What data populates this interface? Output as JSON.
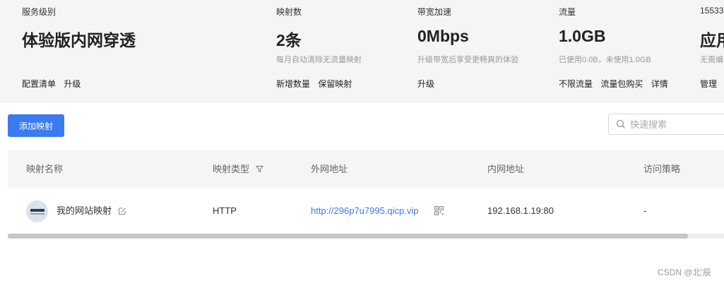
{
  "stats": [
    {
      "label": "服务级别",
      "value": "体验版内网穿透",
      "sub": "",
      "links": [
        "配置清单",
        "升级"
      ]
    },
    {
      "label": "映射数",
      "value": "2条",
      "sub": "每月自动清除无流量映射",
      "links": [
        "新增数量",
        "保留映射"
      ]
    },
    {
      "label": "带宽加速",
      "value": "0Mbps",
      "sub": "升级带宽后享受更畅爽的体验",
      "links": [
        "升级"
      ]
    },
    {
      "label": "流量",
      "value": "1.0GB",
      "sub": "已使用0.0B，未使用1.0GB",
      "links": [
        "不限流量",
        "流量包购买",
        "详情"
      ]
    },
    {
      "label": "15533",
      "value": "应用",
      "sub": "无需编",
      "links": [
        "管理"
      ]
    }
  ],
  "toolbar": {
    "add_label": "添加映射",
    "search_placeholder": "快速搜索"
  },
  "table": {
    "headers": [
      "映射名称",
      "映射类型",
      "外网地址",
      "内网地址",
      "访问策略"
    ],
    "rows": [
      {
        "name": "我的网站映射",
        "type": "HTTP",
        "external": "http://296p7u7995.qicp.vip",
        "internal": "192.168.1.19:80",
        "policy": "-"
      }
    ]
  },
  "scrollbar": {
    "visible_fraction": 0.95
  },
  "footer": "CSDN @北'辰",
  "colors": {
    "accent": "#3a7bf0",
    "panel_bg": "#f5f5f5"
  }
}
